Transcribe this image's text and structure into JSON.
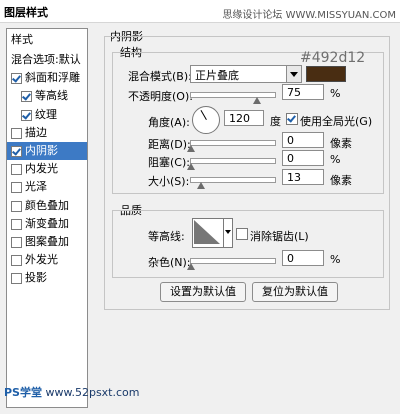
{
  "window": {
    "title": "图层样式",
    "watermark": "思缘设计论坛 WWW.MISSYUAN.COM"
  },
  "sidebar": {
    "header": "样式",
    "items": [
      {
        "label": "混合选项:默认",
        "checkbox": false,
        "checked": false,
        "indent": false,
        "selected": false
      },
      {
        "label": "斜面和浮雕",
        "checkbox": true,
        "checked": true,
        "indent": false,
        "selected": false
      },
      {
        "label": "等高线",
        "checkbox": true,
        "checked": true,
        "indent": true,
        "selected": false
      },
      {
        "label": "纹理",
        "checkbox": true,
        "checked": true,
        "indent": true,
        "selected": false
      },
      {
        "label": "描边",
        "checkbox": true,
        "checked": false,
        "indent": false,
        "selected": false
      },
      {
        "label": "内阴影",
        "checkbox": true,
        "checked": true,
        "indent": false,
        "selected": true
      },
      {
        "label": "内发光",
        "checkbox": true,
        "checked": false,
        "indent": false,
        "selected": false
      },
      {
        "label": "光泽",
        "checkbox": true,
        "checked": false,
        "indent": false,
        "selected": false
      },
      {
        "label": "颜色叠加",
        "checkbox": true,
        "checked": false,
        "indent": false,
        "selected": false
      },
      {
        "label": "渐变叠加",
        "checkbox": true,
        "checked": false,
        "indent": false,
        "selected": false
      },
      {
        "label": "图案叠加",
        "checkbox": true,
        "checked": false,
        "indent": false,
        "selected": false
      },
      {
        "label": "外发光",
        "checkbox": true,
        "checked": false,
        "indent": false,
        "selected": false
      },
      {
        "label": "投影",
        "checkbox": true,
        "checked": false,
        "indent": false,
        "selected": false
      }
    ]
  },
  "inner_shadow": {
    "section_title": "内阴影",
    "structure": {
      "title": "结构",
      "blend_mode_label": "混合模式(B):",
      "blend_mode_value": "正片叠底",
      "color": "#492d12",
      "color_label": "#492d12",
      "opacity_label": "不透明度(O):",
      "opacity_value": "75",
      "opacity_unit": "%",
      "angle_label": "角度(A):",
      "angle_value": "120",
      "angle_unit": "度",
      "global_light_label": "使用全局光(G)",
      "global_light_checked": true,
      "distance_label": "距离(D):",
      "distance_value": "0",
      "distance_unit": "像素",
      "choke_label": "阻塞(C):",
      "choke_value": "0",
      "choke_unit": "%",
      "size_label": "大小(S):",
      "size_value": "13",
      "size_unit": "像素"
    },
    "quality": {
      "title": "品质",
      "contour_label": "等高线:",
      "anti_alias_label": "消除锯齿(L)",
      "anti_alias_checked": false,
      "noise_label": "杂色(N):",
      "noise_value": "0",
      "noise_unit": "%"
    },
    "buttons": {
      "set_default": "设置为默认值",
      "reset_default": "复位为默认值"
    }
  },
  "footer_watermark": {
    "brand": "PS学堂",
    "url": "www.52psxt.com"
  }
}
